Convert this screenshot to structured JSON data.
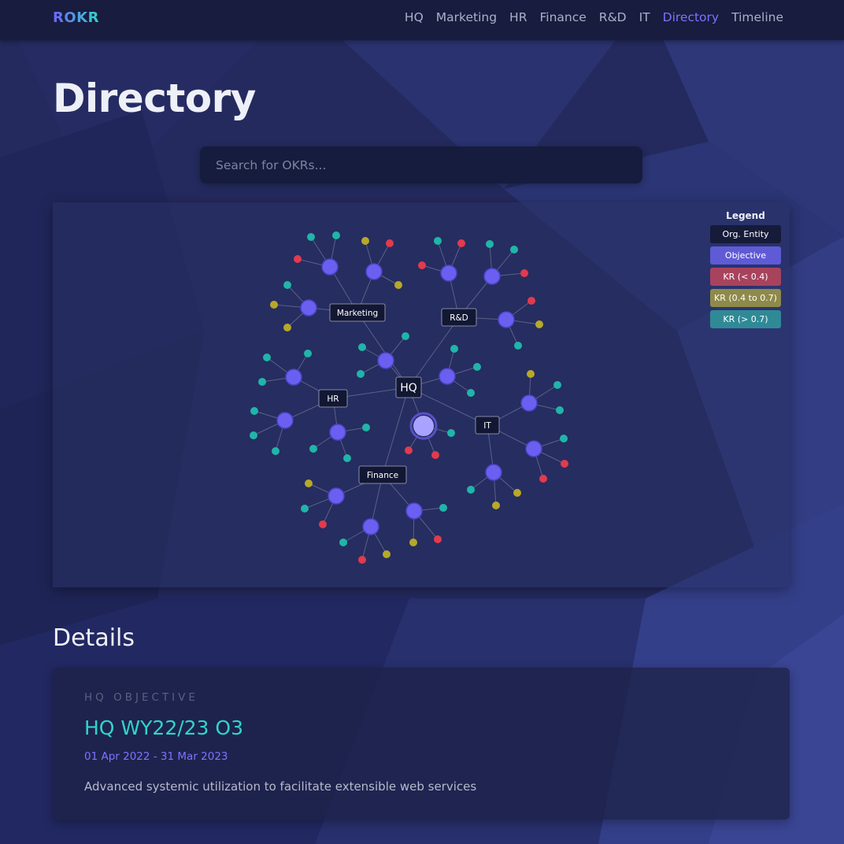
{
  "app": {
    "logo": "ROKR"
  },
  "nav": {
    "items": [
      "HQ",
      "Marketing",
      "HR",
      "Finance",
      "R&D",
      "IT",
      "Directory",
      "Timeline"
    ],
    "active": "Directory"
  },
  "page": {
    "title": "Directory"
  },
  "search": {
    "placeholder": "Search for OKRs...",
    "value": ""
  },
  "graph": {
    "root": "HQ",
    "entities": [
      "Marketing",
      "R&D",
      "HR",
      "IT",
      "Finance"
    ],
    "legend": {
      "title": "Legend",
      "items": [
        {
          "label": "Org. Entity",
          "color": "#161b3a"
        },
        {
          "label": "Objective",
          "color": "#5f5bd6"
        },
        {
          "label": "KR (< 0.4)",
          "color": "#a8435e"
        },
        {
          "label": "KR (0.4 to 0.7)",
          "color": "#8e8a4a"
        },
        {
          "label": "KR (> 0.7)",
          "color": "#2f8a96"
        }
      ]
    },
    "colors": {
      "objective": "#6a5ff0",
      "kr_low": "#e23a4e",
      "kr_mid": "#b7a82a",
      "kr_high": "#20b5a9",
      "link": "#6e7397"
    }
  },
  "details": {
    "section_title": "Details",
    "kicker": "HQ OBJECTIVE",
    "title": "HQ WY22/23 O3",
    "dates": "01 Apr 2022 - 31 Mar 2023",
    "description": "Advanced systemic utilization to facilitate extensible web services"
  }
}
